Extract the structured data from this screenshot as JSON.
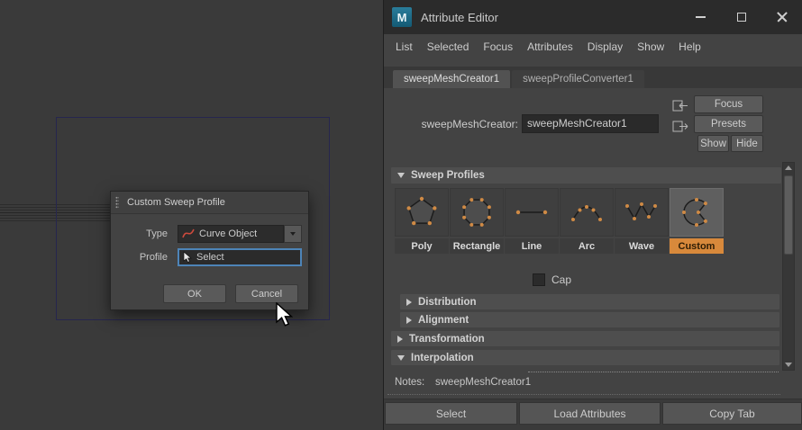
{
  "viewport": {
    "dialog": {
      "title": "Custom Sweep Profile",
      "type_label": "Type",
      "type_value": "Curve Object",
      "profile_label": "Profile",
      "profile_value": "Select",
      "ok_label": "OK",
      "cancel_label": "Cancel"
    }
  },
  "window": {
    "logo": "M",
    "title": "Attribute Editor"
  },
  "menubar": {
    "items": [
      "List",
      "Selected",
      "Focus",
      "Attributes",
      "Display",
      "Show",
      "Help"
    ]
  },
  "tabs": [
    "sweepMeshCreator1",
    "sweepProfileConverter1"
  ],
  "node": {
    "label": "sweepMeshCreator:",
    "value": "sweepMeshCreator1",
    "focus_label": "Focus",
    "presets_label": "Presets",
    "show_label": "Show",
    "hide_label": "Hide"
  },
  "sections": {
    "sweep_profiles": "Sweep Profiles",
    "distribution": "Distribution",
    "alignment": "Alignment",
    "transformation": "Transformation",
    "interpolation": "Interpolation"
  },
  "profiles": [
    {
      "label": "Poly"
    },
    {
      "label": "Rectangle"
    },
    {
      "label": "Line"
    },
    {
      "label": "Arc"
    },
    {
      "label": "Wave"
    },
    {
      "label": "Custom"
    }
  ],
  "cap_label": "Cap",
  "notes": {
    "label": "Notes:",
    "value": "sweepMeshCreator1"
  },
  "footer": {
    "select_label": "Select",
    "load_label": "Load Attributes",
    "copy_label": "Copy Tab"
  },
  "colors": {
    "accent_orange": "#d8893b",
    "selection_blue": "#4d84b8",
    "panel_gray": "#434343"
  }
}
